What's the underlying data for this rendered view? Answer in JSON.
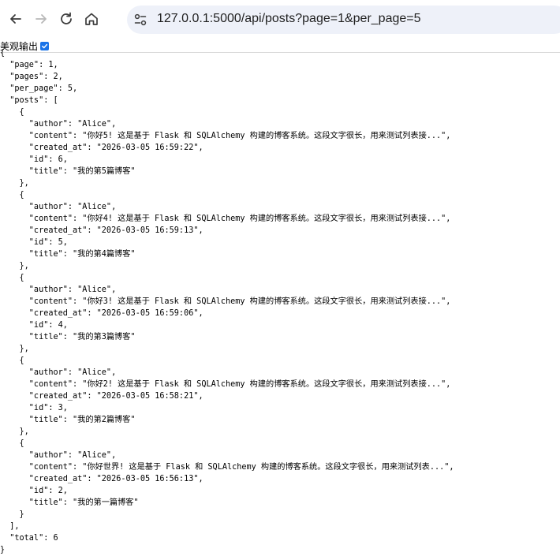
{
  "browser": {
    "url": "127.0.0.1:5000/api/posts?page=1&per_page=5",
    "icons": [
      "back-arrow-icon",
      "forward-arrow-icon",
      "reload-icon",
      "home-icon",
      "site-info-icon"
    ]
  },
  "pretty_print": {
    "label": "美观输出",
    "checked": true
  },
  "json_lines": [
    "{",
    "  \"page\": 1,",
    "  \"pages\": 2,",
    "  \"per_page\": 5,",
    "  \"posts\": [",
    "    {",
    "      \"author\": \"Alice\",",
    "      \"content\": \"你好5! 这是基于 Flask 和 SQLAlchemy 构建的博客系统。这段文字很长，用来测试列表接...\",",
    "      \"created_at\": \"2026-03-05 16:59:22\",",
    "      \"id\": 6,",
    "      \"title\": \"我的第5篇博客\"",
    "    },",
    "    {",
    "      \"author\": \"Alice\",",
    "      \"content\": \"你好4! 这是基于 Flask 和 SQLAlchemy 构建的博客系统。这段文字很长，用来测试列表接...\",",
    "      \"created_at\": \"2026-03-05 16:59:13\",",
    "      \"id\": 5,",
    "      \"title\": \"我的第4篇博客\"",
    "    },",
    "    {",
    "      \"author\": \"Alice\",",
    "      \"content\": \"你好3! 这是基于 Flask 和 SQLAlchemy 构建的博客系统。这段文字很长，用来测试列表接...\",",
    "      \"created_at\": \"2026-03-05 16:59:06\",",
    "      \"id\": 4,",
    "      \"title\": \"我的第3篇博客\"",
    "    },",
    "    {",
    "      \"author\": \"Alice\",",
    "      \"content\": \"你好2! 这是基于 Flask 和 SQLAlchemy 构建的博客系统。这段文字很长，用来测试列表接...\",",
    "      \"created_at\": \"2026-03-05 16:58:21\",",
    "      \"id\": 3,",
    "      \"title\": \"我的第2篇博客\"",
    "    },",
    "    {",
    "      \"author\": \"Alice\",",
    "      \"content\": \"你好世界! 这是基于 Flask 和 SQLAlchemy 构建的博客系统。这段文字很长，用来测试列表...\",",
    "      \"created_at\": \"2026-03-05 16:56:13\",",
    "      \"id\": 2,",
    "      \"title\": \"我的第一篇博客\"",
    "    }",
    "  ],",
    "  \"total\": 6",
    "}"
  ]
}
